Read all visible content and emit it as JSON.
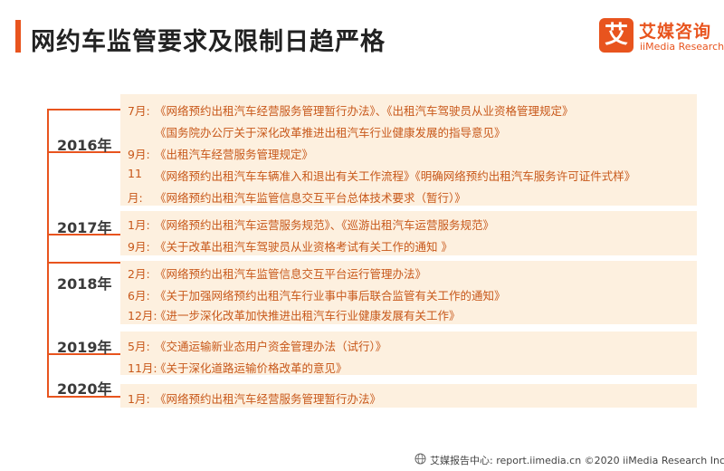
{
  "page": {
    "title": "网约车监管要求及限制日趋严格",
    "accent_color": "#e8541e",
    "box_color": "#fdf0df",
    "text_color": "#c8581a"
  },
  "logo": {
    "mark": "艾",
    "cn": "艾媒咨询",
    "en": "iiMedia Research"
  },
  "timeline": [
    {
      "year": "2016年",
      "lines": [
        {
          "month": "7月:",
          "text": "《网络预约出租汽车经营服务管理暂行办法》、《出租汽车驾驶员从业资格管理规定》"
        },
        {
          "month": "",
          "text": "《国务院办公厅关于深化改革推进出租汽车行业健康发展的指导意见》"
        },
        {
          "month": "9月:",
          "text": "《出租汽车经营服务管理规定》"
        },
        {
          "month": "11",
          "text": "《网络预约出租汽车车辆准入和退出有关工作流程》《明确网络预约出租汽车服务许可证件式样》"
        },
        {
          "month": "月:",
          "text": "《网络预约出租汽车监管信息交互平台总体技术要求（暂行）》"
        }
      ]
    },
    {
      "year": "2017年",
      "lines": [
        {
          "month": "1月:",
          "text": "《网络预约出租汽车运营服务规范》、《巡游出租汽车运营服务规范》"
        },
        {
          "month": "9月:",
          "text": "《关于改革出租汽车驾驶员从业资格考试有关工作的通知 》"
        }
      ]
    },
    {
      "year": "2018年",
      "lines": [
        {
          "month": "2月:",
          "text": "《网络预约出租汽车监管信息交互平台运行管理办法》"
        },
        {
          "month": "6月:",
          "text": "《关于加强网络预约出租汽车行业事中事后联合监管有关工作的通知》"
        },
        {
          "month": "12月:",
          "text": "《进一步深化改革加快推进出租汽车行业健康发展有关工作》"
        }
      ]
    },
    {
      "year": "2019年",
      "lines": [
        {
          "month": "5月:",
          "text": "《交通运输新业态用户资金管理办法（试行）》"
        },
        {
          "month": "11月:",
          "text": "《关于深化道路运输价格改革的意见》"
        }
      ]
    },
    {
      "year": "2020年",
      "lines": [
        {
          "month": "1月:",
          "text": "《网络预约出租汽车经营服务管理暂行办法》"
        }
      ]
    }
  ],
  "footer": {
    "text": "艾媒报告中心: report.iimedia.cn ©2020  iiMedia Research  Inc"
  }
}
